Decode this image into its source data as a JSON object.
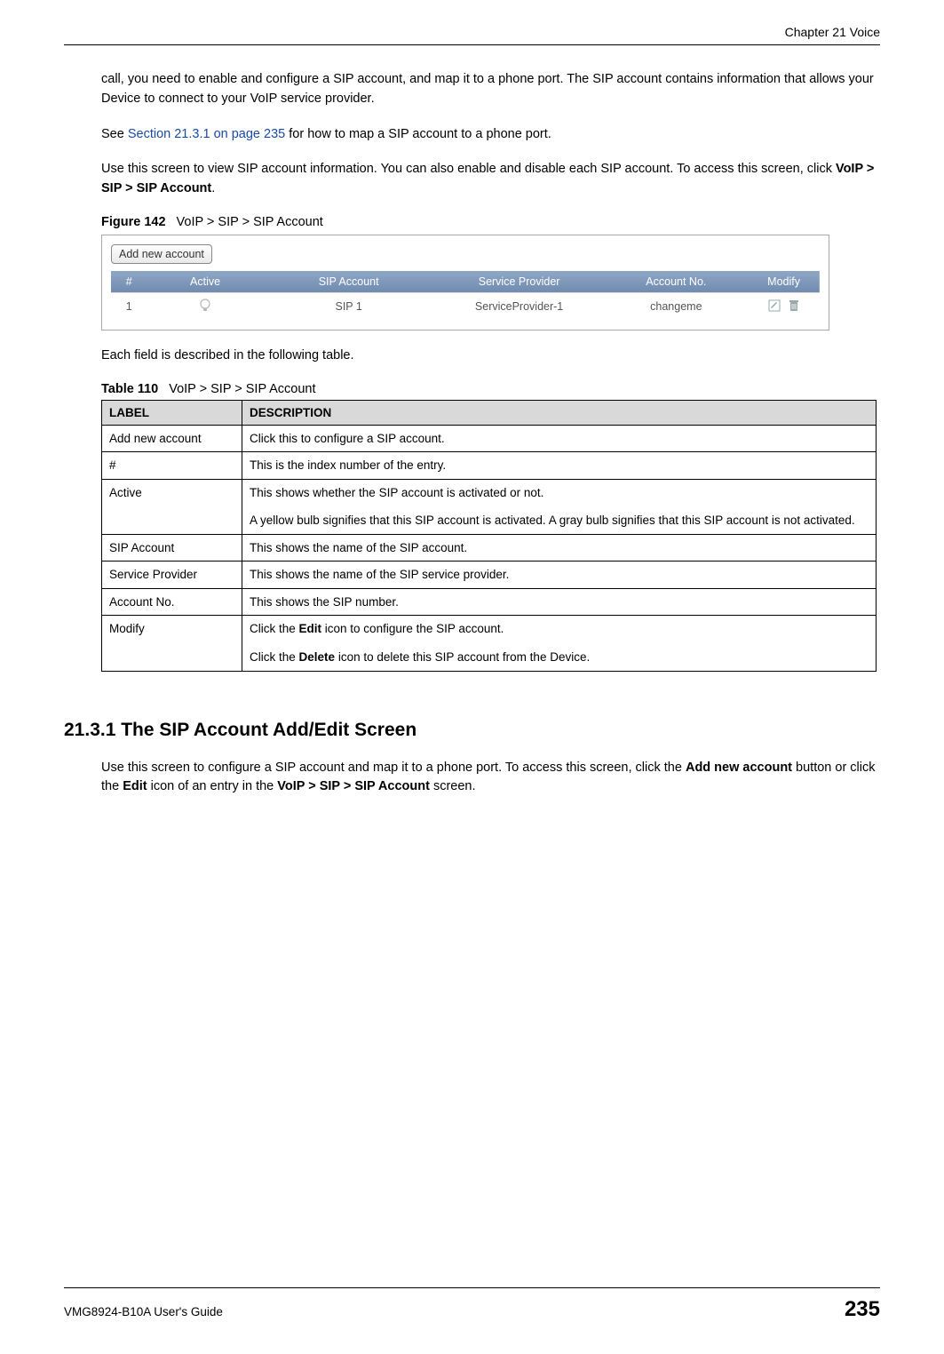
{
  "chapterHeader": "Chapter 21 Voice",
  "paras": {
    "p1": "call, you need to enable and configure a SIP account, and map it to a phone port. The SIP account contains information that allows your Device to connect to your VoIP service provider.",
    "p2a": "See ",
    "p2link": "Section 21.3.1 on page 235",
    "p2b": " for how to map a SIP account to a phone port.",
    "p3a": "Use this screen to view SIP account information. You can also enable and disable each SIP account. To access this screen, click ",
    "p3bold": "VoIP > SIP > SIP Account",
    "p3b": ".",
    "eachField": "Each field is described in the following table."
  },
  "figure": {
    "labelNo": "Figure 142",
    "labelText": "VoIP > SIP > SIP Account",
    "addBtn": "Add new account",
    "headers": {
      "num": "#",
      "active": "Active",
      "sip": "SIP Account",
      "provider": "Service Provider",
      "acct": "Account No.",
      "modify": "Modify"
    },
    "row": {
      "num": "1",
      "sip": "SIP 1",
      "provider": "ServiceProvider-1",
      "acct": "changeme"
    }
  },
  "table110": {
    "labelNo": "Table 110",
    "labelText": "VoIP > SIP > SIP Account",
    "header": {
      "label": "LABEL",
      "desc": "DESCRIPTION"
    },
    "rows": {
      "addnew": {
        "label": "Add new account",
        "desc": "Click this to configure a SIP account."
      },
      "hash": {
        "label": "#",
        "desc": "This is the index number of the entry."
      },
      "active": {
        "label": "Active",
        "desc1": "This shows whether the SIP account is activated or not.",
        "desc2": "A yellow bulb signifies that this SIP account is activated. A gray bulb signifies that this SIP account is not activated."
      },
      "sip": {
        "label": "SIP Account",
        "desc": "This shows the name of the SIP account."
      },
      "provider": {
        "label": "Service Provider",
        "desc": "This shows the name of the SIP service provider."
      },
      "acctno": {
        "label": "Account No.",
        "desc": "This shows the SIP number."
      },
      "modify": {
        "label": "Modify",
        "desc1a": "Click the ",
        "desc1bold": "Edit",
        "desc1b": " icon to configure the SIP account.",
        "desc2a": "Click the ",
        "desc2bold": "Delete",
        "desc2b": " icon to delete this SIP account from the Device."
      }
    }
  },
  "section": {
    "heading": "21.3.1  The SIP Account Add/Edit Screen",
    "p1a": "Use this screen to configure a SIP account and map it to a phone port. To access this screen, click the ",
    "p1b1": "Add new account",
    "p1c": " button or click the ",
    "p1b2": "Edit",
    "p1d": " icon of an entry in the ",
    "p1b3": "VoIP > SIP > SIP Account",
    "p1e": " screen."
  },
  "footer": {
    "guide": "VMG8924-B10A User's Guide",
    "page": "235"
  }
}
